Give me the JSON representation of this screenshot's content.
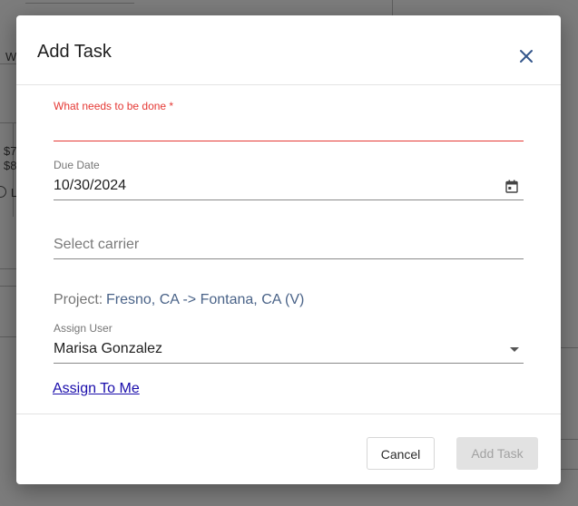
{
  "background": {
    "peek_texts": [
      "W",
      "$7",
      "$8",
      "L"
    ]
  },
  "dialog": {
    "title": "Add Task",
    "fields": {
      "task": {
        "label": "What needs to be done *",
        "value": ""
      },
      "due_date": {
        "label": "Due Date",
        "value": "10/30/2024"
      },
      "carrier": {
        "placeholder": "Select carrier"
      },
      "project": {
        "label": "Project:",
        "value": "Fresno, CA -> Fontana, CA (V)"
      },
      "assign_user": {
        "label": "Assign User",
        "value": "Marisa Gonzalez"
      }
    },
    "assign_to_me_link": "Assign To Me",
    "buttons": {
      "cancel": "Cancel",
      "add_task": "Add Task"
    }
  },
  "colors": {
    "error": "#e53935",
    "link": "#1a0dab",
    "project_value": "#4a6388",
    "disabled_button_bg": "#e2e2e2"
  },
  "icons": [
    "close-icon",
    "calendar-icon",
    "dropdown-arrow-icon",
    "radio-icon"
  ]
}
